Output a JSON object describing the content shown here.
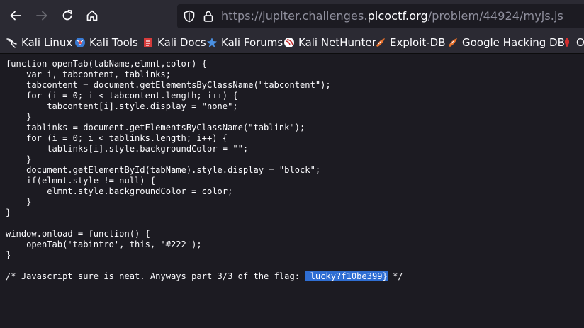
{
  "browser": {
    "url_prefix": "https://jupiter.challenges.",
    "url_host": "picoctf.org",
    "url_path": "/problem/44924/myjs.js"
  },
  "bookmarks": [
    {
      "label": "Kali Linux",
      "icon": "kali-dragon-icon"
    },
    {
      "label": "Kali Tools",
      "icon": "kali-tools-icon"
    },
    {
      "label": "Kali Docs",
      "icon": "kali-docs-icon"
    },
    {
      "label": "Kali Forums",
      "icon": "kali-forums-icon"
    },
    {
      "label": "Kali NetHunter",
      "icon": "nethunter-icon"
    },
    {
      "label": "Exploit-DB",
      "icon": "exploit-db-icon"
    },
    {
      "label": "Google Hacking DB",
      "icon": "ghdb-icon"
    },
    {
      "label": "Of",
      "icon": "offsec-icon"
    }
  ],
  "code": {
    "lines": [
      "function openTab(tabName,elmnt,color) {",
      "    var i, tabcontent, tablinks;",
      "    tabcontent = document.getElementsByClassName(\"tabcontent\");",
      "    for (i = 0; i < tabcontent.length; i++) {",
      "        tabcontent[i].style.display = \"none\";",
      "    }",
      "    tablinks = document.getElementsByClassName(\"tablink\");",
      "    for (i = 0; i < tablinks.length; i++) {",
      "        tablinks[i].style.backgroundColor = \"\";",
      "    }",
      "    document.getElementById(tabName).style.display = \"block\";",
      "    if(elmnt.style != null) {",
      "        elmnt.style.backgroundColor = color;",
      "    }",
      "}",
      "",
      "window.onload = function() {",
      "    openTab('tabintro', this, '#222');",
      "}",
      ""
    ],
    "comment_before": "/* Javascript sure is neat. Anyways part 3/3 of the flag: ",
    "flag_selected": "_lucky?f10be399}",
    "comment_after": " */"
  }
}
